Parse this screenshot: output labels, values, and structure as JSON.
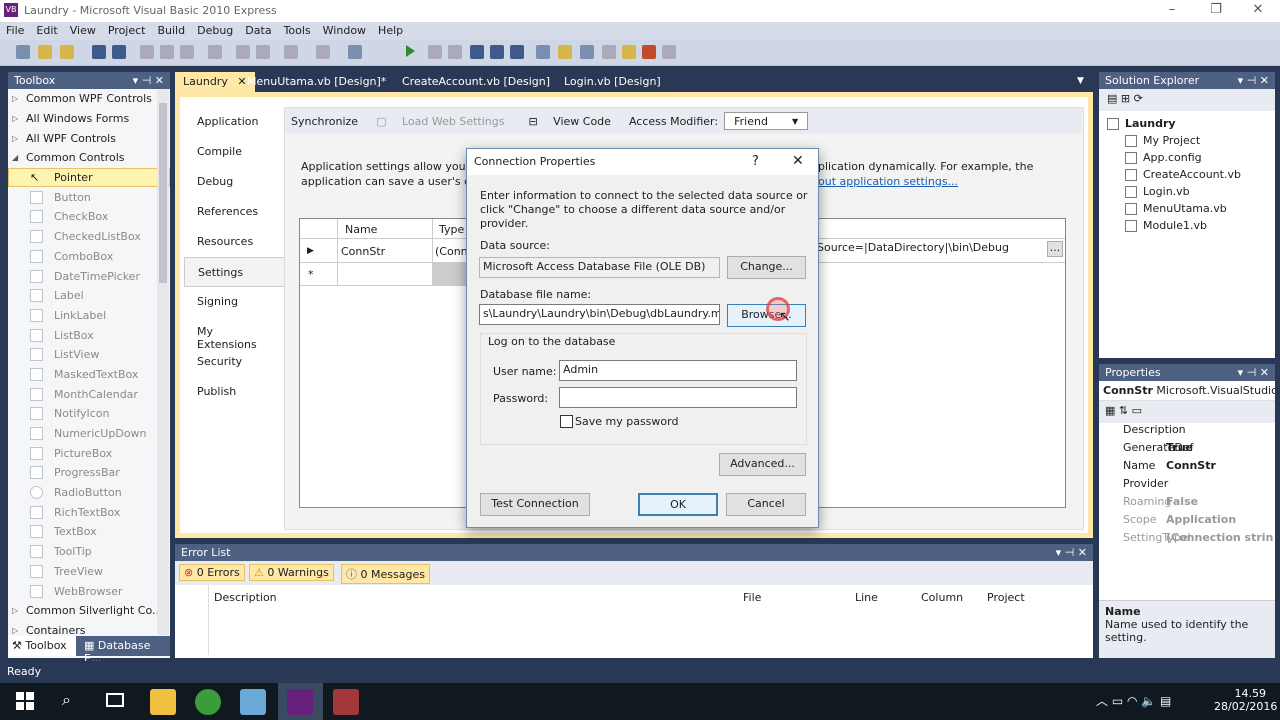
{
  "window": {
    "title": "Laundry - Microsoft Visual Basic 2010 Express"
  },
  "menu": [
    "File",
    "Edit",
    "View",
    "Project",
    "Build",
    "Debug",
    "Data",
    "Tools",
    "Window",
    "Help"
  ],
  "toolbox": {
    "title": "Toolbox",
    "groups_top": [
      "Common WPF Controls",
      "All Windows Forms",
      "All WPF Controls",
      "Common Controls"
    ],
    "items": [
      "Pointer",
      "Button",
      "CheckBox",
      "CheckedListBox",
      "ComboBox",
      "DateTimePicker",
      "Label",
      "LinkLabel",
      "ListBox",
      "ListView",
      "MaskedTextBox",
      "MonthCalendar",
      "NotifyIcon",
      "NumericUpDown",
      "PictureBox",
      "ProgressBar",
      "RadioButton",
      "RichTextBox",
      "TextBox",
      "ToolTip",
      "TreeView",
      "WebBrowser"
    ],
    "groups_bottom": [
      "Common Silverlight Co...",
      "Containers"
    ],
    "tab_toolbox": "Toolbox",
    "tab_db": "Database E..."
  },
  "doc_tabs": [
    "Laundry",
    "MenuUtama.vb [Design]*",
    "CreateAccount.vb [Design]",
    "Login.vb [Design]"
  ],
  "project_tabs": [
    "Application",
    "Compile",
    "Debug",
    "References",
    "Resources",
    "Settings",
    "Signing",
    "My Extensions",
    "Security",
    "Publish"
  ],
  "settings": {
    "synchronize": "Synchronize",
    "load_web": "Load Web Settings",
    "view_code": "View Code",
    "access_modifier": "Access Modifier:",
    "access_value": "Friend",
    "desc1": "Application settings allow you to",
    "desc1b": "plication dynamically. For example, the",
    "desc2": "application can save a user's colo",
    "link": "out application settings...",
    "col_name": "Name",
    "col_type": "Type",
    "row_name": "ConnStr",
    "row_type": "(Conn",
    "row_value": "Source=|DataDirectory|\\bin\\Debug",
    "ellipsis": "..."
  },
  "dialog": {
    "title": "Connection Properties",
    "help": "?",
    "intro": "Enter information to connect to the selected data source or click \"Change\" to choose a different data source and/or provider.",
    "ds_label": "Data source:",
    "ds_value": "Microsoft Access Database File (OLE DB)",
    "change": "Change...",
    "db_label": "Database file name:",
    "db_value": "s\\Laundry\\Laundry\\bin\\Debug\\dbLaundry.mdb",
    "browse": "Browse...",
    "logon": "Log on to the database",
    "user_label": "User name:",
    "user_value": "Admin",
    "pass_label": "Password:",
    "save_pw": "Save my password",
    "advanced": "Advanced...",
    "test": "Test Connection",
    "ok": "OK",
    "cancel": "Cancel"
  },
  "errors": {
    "title": "Error List",
    "errors": "0 Errors",
    "warnings": "0 Warnings",
    "messages": "0 Messages",
    "cols": [
      "Description",
      "File",
      "Line",
      "Column",
      "Project"
    ]
  },
  "solution": {
    "title": "Solution Explorer",
    "root": "Laundry",
    "items": [
      "My Project",
      "App.config",
      "CreateAccount.vb",
      "Login.vb",
      "MenuUtama.vb",
      "Module1.vb"
    ]
  },
  "properties": {
    "title": "Properties",
    "object": "ConnStr",
    "object_type": "Microsoft.VisualStudio",
    "rows": [
      {
        "k": "Description",
        "v": ""
      },
      {
        "k": "GenerateDef",
        "v": "True"
      },
      {
        "k": "Name",
        "v": "ConnStr"
      },
      {
        "k": "Provider",
        "v": ""
      },
      {
        "k": "Roaming",
        "v": "False"
      },
      {
        "k": "Scope",
        "v": "Application"
      },
      {
        "k": "SettingTypeI",
        "v": "(Connection strin"
      }
    ],
    "help_title": "Name",
    "help_text": "Name used to identify the setting."
  },
  "status": "Ready",
  "clock": {
    "time": "14.59",
    "date": "28/02/2016"
  }
}
